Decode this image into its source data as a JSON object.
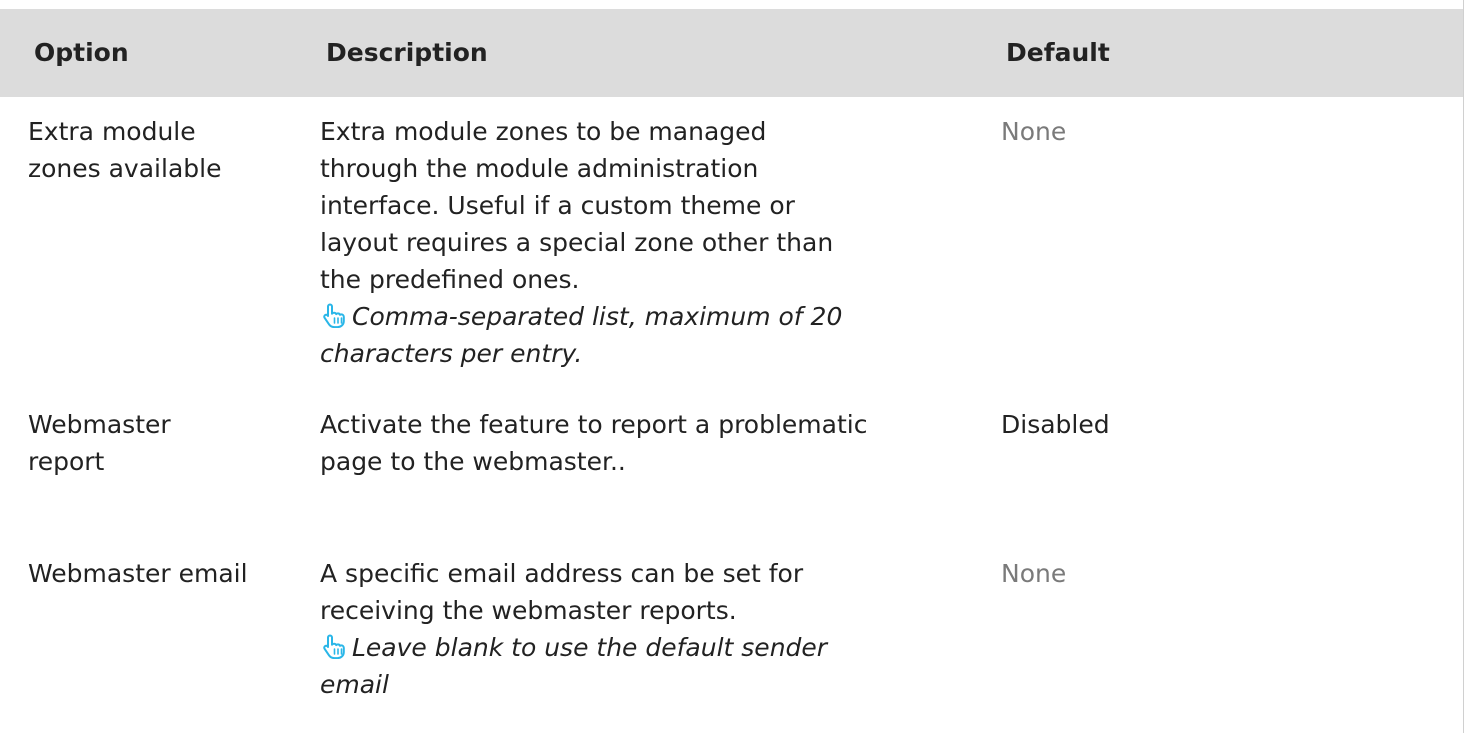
{
  "table": {
    "headers": {
      "option": "Option",
      "description": "Description",
      "default": "Default"
    },
    "rows": [
      {
        "option": [
          "Extra module",
          "zones available"
        ],
        "description": [
          "Extra module zones to be managed",
          "through the module administration",
          "interface. Useful if a custom theme or",
          "layout requires a special zone other than",
          "the predefined ones."
        ],
        "note": [
          "Comma-separated list, maximum of 20",
          "characters per entry."
        ],
        "default": "None",
        "default_style": "muted"
      },
      {
        "option": [
          "Webmaster",
          "report"
        ],
        "description": [
          "Activate the feature to report a problematic",
          "page to the webmaster.."
        ],
        "default": "Disabled",
        "default_style": "normal"
      },
      {
        "option": [
          "Webmaster email"
        ],
        "description": [
          "A specific email address can be set for",
          "receiving the webmaster reports."
        ],
        "note": [
          "Leave blank to use the default sender",
          "email"
        ],
        "default": "None",
        "default_style": "muted"
      }
    ]
  },
  "icons": {
    "note_icon": "pointing-hand-icon"
  },
  "colors": {
    "header_bg": "#dcdcdc",
    "muted_text": "#7a7a7a",
    "icon_accent": "#29b6e8"
  }
}
